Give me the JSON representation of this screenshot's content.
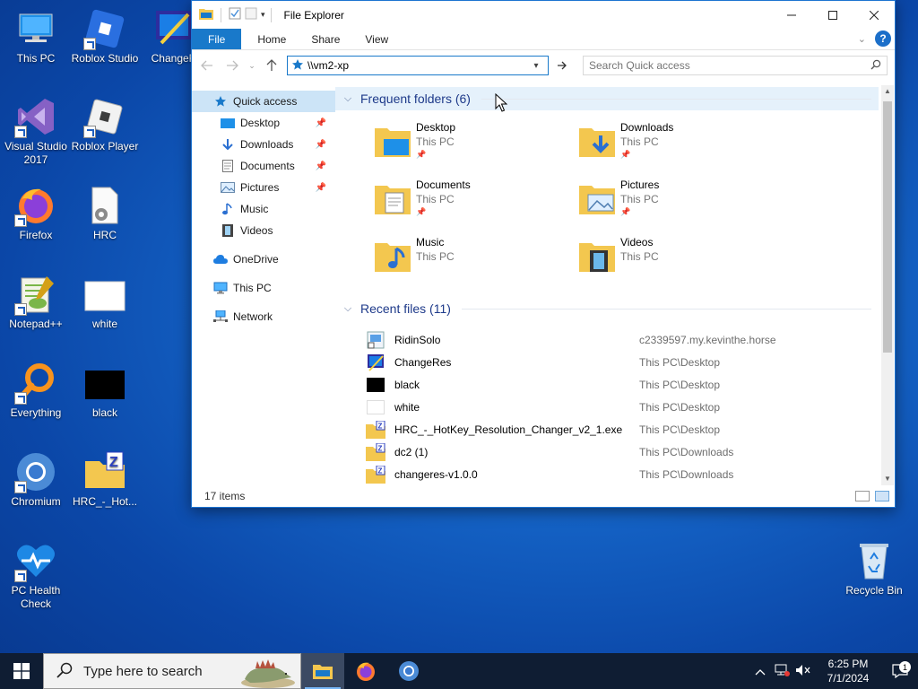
{
  "desktop": {
    "icons": [
      {
        "label": "This PC",
        "icon": "this-pc-icon"
      },
      {
        "label": "Roblox Studio",
        "icon": "roblox-studio-icon"
      },
      {
        "label": "ChangeR",
        "icon": "changeres-icon"
      },
      {
        "label": "Visual Studio\n2017",
        "icon": "visual-studio-icon"
      },
      {
        "label": "Roblox Player",
        "icon": "roblox-player-icon"
      },
      {
        "label": "Firefox",
        "icon": "firefox-icon"
      },
      {
        "label": "HRC",
        "icon": "hrc-icon"
      },
      {
        "label": "Notepad++",
        "icon": "notepadpp-icon"
      },
      {
        "label": "white",
        "icon": "white-image-icon"
      },
      {
        "label": "Everything",
        "icon": "everything-icon"
      },
      {
        "label": "black",
        "icon": "black-image-icon"
      },
      {
        "label": "Chromium",
        "icon": "chromium-icon"
      },
      {
        "label": "HRC_-_Hot...",
        "icon": "zip-folder-icon"
      },
      {
        "label": "PC Health\nCheck",
        "icon": "pc-health-check-icon"
      },
      {
        "label": "Recycle Bin",
        "icon": "recycle-bin-icon"
      }
    ]
  },
  "window": {
    "title": "File Explorer",
    "ribbon": {
      "file": "File",
      "home": "Home",
      "share": "Share",
      "view": "View"
    },
    "address": "\\\\vm2-xp",
    "search_placeholder": "Search Quick access",
    "navpane": {
      "quick_access": "Quick access",
      "desktop": "Desktop",
      "downloads": "Downloads",
      "documents": "Documents",
      "pictures": "Pictures",
      "music": "Music",
      "videos": "Videos",
      "onedrive": "OneDrive",
      "this_pc": "This PC",
      "network": "Network"
    },
    "frequent": {
      "header": "Frequent folders (6)",
      "folders": [
        {
          "name": "Desktop",
          "location": "This PC",
          "pinned": true
        },
        {
          "name": "Downloads",
          "location": "This PC",
          "pinned": true
        },
        {
          "name": "Documents",
          "location": "This PC",
          "pinned": true
        },
        {
          "name": "Pictures",
          "location": "This PC",
          "pinned": true
        },
        {
          "name": "Music",
          "location": "This PC",
          "pinned": false
        },
        {
          "name": "Videos",
          "location": "This PC",
          "pinned": false
        }
      ]
    },
    "recent": {
      "header": "Recent files (11)",
      "files": [
        {
          "name": "RidinSolo",
          "path": "c2339597.my.kevinthe.horse"
        },
        {
          "name": "ChangeRes",
          "path": "This PC\\Desktop"
        },
        {
          "name": "black",
          "path": "This PC\\Desktop"
        },
        {
          "name": "white",
          "path": "This PC\\Desktop"
        },
        {
          "name": "HRC_-_HotKey_Resolution_Changer_v2_1.exe",
          "path": "This PC\\Desktop"
        },
        {
          "name": "dc2 (1)",
          "path": "This PC\\Downloads"
        },
        {
          "name": "changeres-v1.0.0",
          "path": "This PC\\Downloads"
        }
      ]
    },
    "status": "17 items"
  },
  "taskbar": {
    "search_placeholder": "Type here to search",
    "time": "6:25 PM",
    "date": "7/1/2024",
    "notification_count": "1"
  },
  "colors": {
    "accent": "#1979ca",
    "selection": "#cce4f7",
    "folder": "#f3c74f",
    "taskbar": "#0f1d33"
  }
}
